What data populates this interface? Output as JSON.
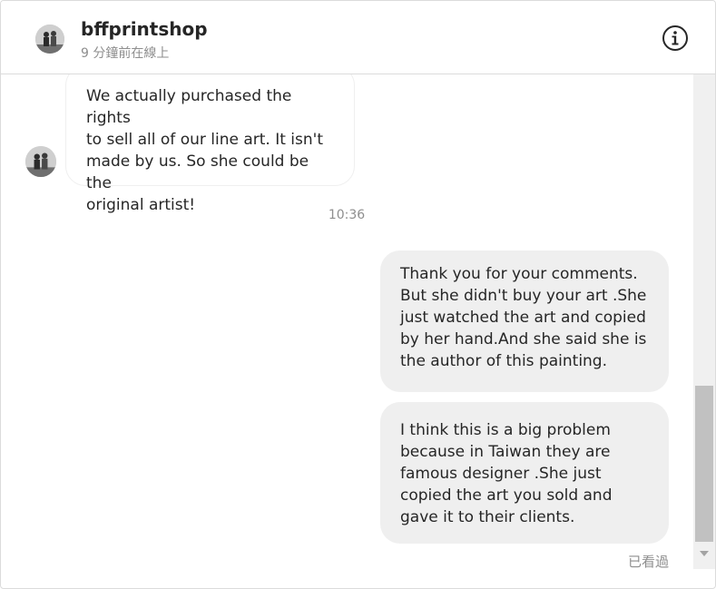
{
  "header": {
    "username": "bffprintshop",
    "status": "9 分鐘前在線上",
    "info_icon": "info-icon"
  },
  "messages": {
    "incoming": [
      {
        "text": "We actually purchased the rights\nto sell all of our line art. It isn't\nmade by us. So she could be the\noriginal artist!"
      }
    ],
    "timestamp": "10:36",
    "outgoing": [
      {
        "text": "Thank you for your comments.\nBut she didn't buy your art .She\njust watched the art and copied\nby her hand.And she said she is\nthe author of this painting."
      },
      {
        "text": "I think this is a big problem\nbecause in Taiwan they are\nfamous designer .She just\ncopied the art you sold and\ngave it to their clients."
      }
    ],
    "seen_label": "已看過"
  },
  "colors": {
    "outgoing_bubble": "#efefef",
    "incoming_border": "#efefef",
    "muted_text": "#8e8e8e",
    "primary_text": "#262626"
  }
}
